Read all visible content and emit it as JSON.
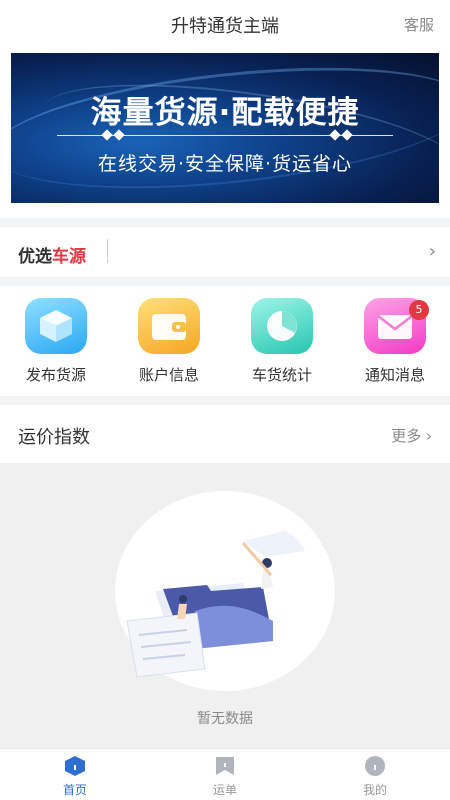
{
  "header": {
    "title": "升特通货主端",
    "service": "客服"
  },
  "banner": {
    "headline": "海量货源·配载便捷",
    "subline": "在线交易·安全保障·货运省心"
  },
  "featured": {
    "label_black": "优选",
    "label_red": "车源"
  },
  "grid": [
    {
      "label": "发布货源",
      "icon": "cube-icon"
    },
    {
      "label": "账户信息",
      "icon": "wallet-icon"
    },
    {
      "label": "车货统计",
      "icon": "pie-chart-icon"
    },
    {
      "label": "通知消息",
      "icon": "mail-icon",
      "badge": "5"
    }
  ],
  "price_index": {
    "title": "运价指数",
    "more": "更多"
  },
  "empty": {
    "text": "暂无数据"
  },
  "tabs": [
    {
      "label": "首页",
      "icon": "home-icon",
      "active": true
    },
    {
      "label": "运单",
      "icon": "waybill-icon",
      "active": false
    },
    {
      "label": "我的",
      "icon": "profile-icon",
      "active": false
    }
  ],
  "colors": {
    "accent": "#2f6fd1",
    "red": "#e1373f"
  }
}
